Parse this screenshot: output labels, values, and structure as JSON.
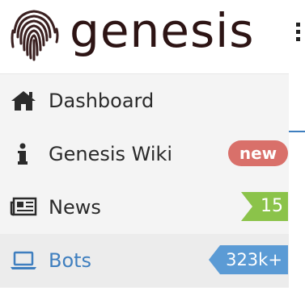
{
  "brand": {
    "name": "genesis",
    "logo_icon": "fingerprint-icon"
  },
  "header": {
    "menu_icon": "vertical-dots-icon"
  },
  "nav": {
    "items": [
      {
        "label": "Dashboard",
        "icon": "home-icon",
        "active": false
      },
      {
        "label": "Genesis Wiki",
        "icon": "info-icon",
        "badge": "new",
        "badge_color": "#d9706a",
        "active": false
      },
      {
        "label": "News",
        "icon": "newspaper-icon",
        "badge": "15",
        "badge_color": "#8bc34a",
        "active": false
      },
      {
        "label": "Bots",
        "icon": "laptop-icon",
        "badge": "323k+",
        "badge_color": "#5b9bd5",
        "active": true
      }
    ]
  },
  "colors": {
    "accent": "#3f7fbf",
    "logo_text": "#2d1414"
  }
}
